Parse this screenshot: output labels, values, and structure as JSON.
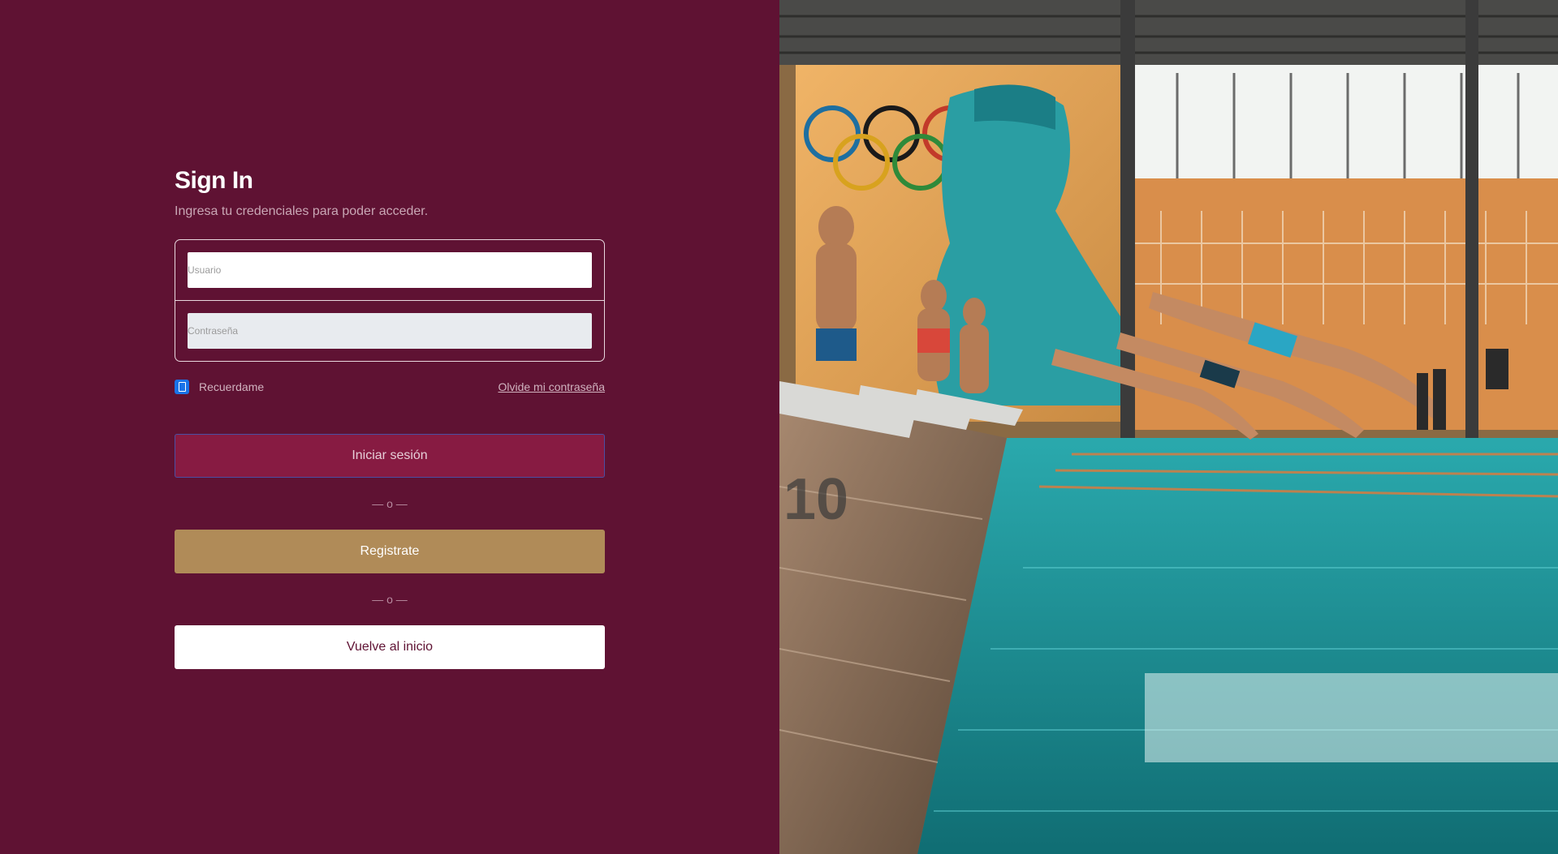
{
  "signin": {
    "title": "Sign In",
    "subtitle": "Ingresa tu credenciales para poder acceder.",
    "username": {
      "placeholder": "Usuario",
      "value": ""
    },
    "password": {
      "placeholder": "Contraseña",
      "value": ""
    },
    "remember_label": "Recuerdame",
    "remember_checked": true,
    "forgot_label": "Olvide mi contraseña",
    "login_label": "Iniciar sesión",
    "divider_1": "— o —",
    "register_label": "Registrate",
    "divider_2": "— o —",
    "home_label": "Vuelve al inicio"
  },
  "hero": {
    "icon": "swimming-pool-photo",
    "colors": {
      "pool": "#1c9aa0",
      "wall": "#e0a35a",
      "roof": "#3a3a3a"
    }
  },
  "colors": {
    "background": "#5f1233",
    "primary_button": "#871b42",
    "register_button": "#b08b58",
    "checkbox": "#1a73e8"
  }
}
